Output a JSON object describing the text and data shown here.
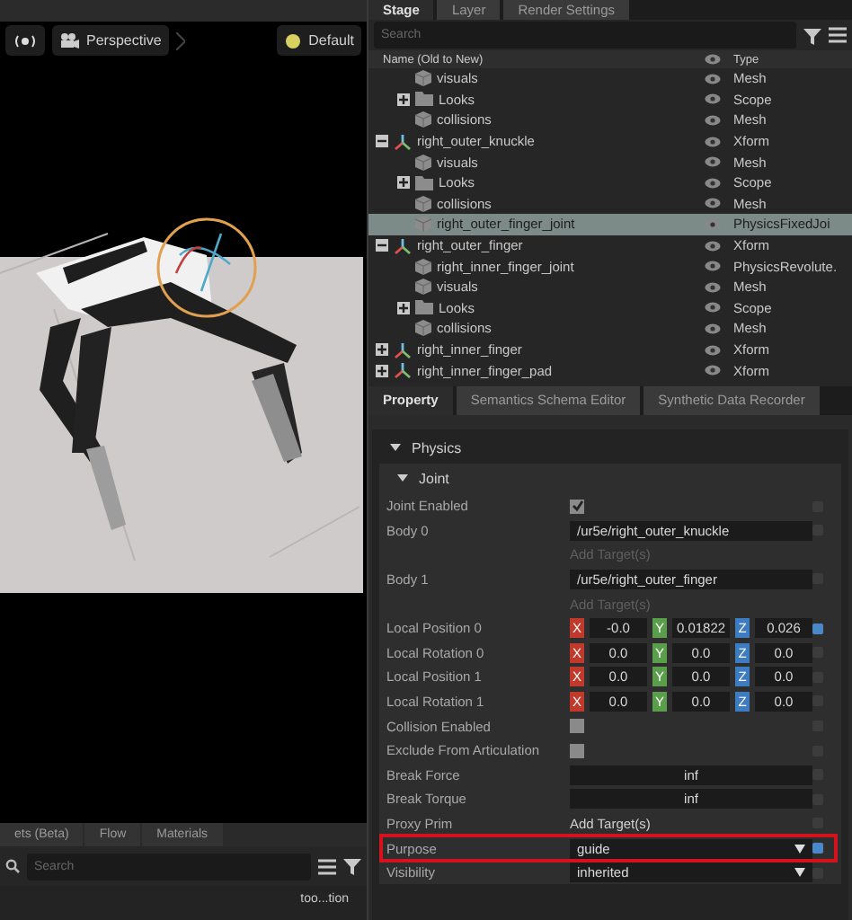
{
  "viewport": {
    "camera": "Perspective",
    "lighting": "Default"
  },
  "bottom_panel": {
    "tabs": [
      {
        "label": "ets (Beta)",
        "selected": false
      },
      {
        "label": "Flow",
        "selected": false
      },
      {
        "label": "Materials",
        "selected": false
      }
    ],
    "search": {
      "placeholder": "Search"
    },
    "tree_item": "too...tion"
  },
  "stage": {
    "tabs": [
      {
        "label": "Stage",
        "selected": true
      },
      {
        "label": "Layer",
        "selected": false
      },
      {
        "label": "Render Settings",
        "selected": false
      }
    ],
    "search": {
      "placeholder": "Search"
    },
    "columns": [
      "Name (Old to New)",
      "Type"
    ],
    "continued_children": [
      {
        "name": "visuals",
        "type": "Mesh",
        "kind": "mesh",
        "selected": false
      },
      {
        "name": "Looks",
        "type": "Scope",
        "kind": "folder",
        "expanded": false,
        "selected": false
      },
      {
        "name": "collisions",
        "type": "Mesh",
        "kind": "mesh",
        "selected": false
      }
    ],
    "nodes": [
      {
        "name": "right_outer_knuckle",
        "type": "Xform",
        "kind": "xform",
        "expanded": true,
        "selected": false,
        "children": [
          {
            "name": "visuals",
            "type": "Mesh",
            "kind": "mesh",
            "selected": false
          },
          {
            "name": "Looks",
            "type": "Scope",
            "kind": "folder",
            "expanded": false,
            "selected": false
          },
          {
            "name": "collisions",
            "type": "Mesh",
            "kind": "mesh",
            "selected": false
          },
          {
            "name": "right_outer_finger_joint",
            "type": "PhysicsFixedJoi",
            "kind": "mesh",
            "selected": true
          }
        ]
      },
      {
        "name": "right_outer_finger",
        "type": "Xform",
        "kind": "xform",
        "expanded": true,
        "selected": false,
        "children": [
          {
            "name": "right_inner_finger_joint",
            "type": "PhysicsRevolute.",
            "kind": "mesh",
            "selected": false
          },
          {
            "name": "visuals",
            "type": "Mesh",
            "kind": "mesh",
            "selected": false
          },
          {
            "name": "Looks",
            "type": "Scope",
            "kind": "folder",
            "expanded": false,
            "selected": false
          },
          {
            "name": "collisions",
            "type": "Mesh",
            "kind": "mesh",
            "selected": false
          }
        ]
      },
      {
        "name": "right_inner_finger",
        "type": "Xform",
        "kind": "xform",
        "expanded": false,
        "selected": false
      },
      {
        "name": "right_inner_finger_pad",
        "type": "Xform",
        "kind": "xform",
        "expanded": false,
        "selected": false
      }
    ]
  },
  "property": {
    "tabs": [
      {
        "label": "Property",
        "selected": true
      },
      {
        "label": "Semantics Schema Editor",
        "selected": false
      },
      {
        "label": "Synthetic Data Recorder",
        "selected": false
      }
    ],
    "section": {
      "title": "Physics",
      "expanded": true
    },
    "group": {
      "title": "Joint",
      "expanded": true
    },
    "fields": [
      {
        "kind": "checkbox",
        "label": "Joint Enabled",
        "checked": true,
        "keyed": false,
        "highlighted": false
      },
      {
        "kind": "target",
        "label": "Body 0",
        "value": "/ur5e/right_outer_knuckle",
        "add_label": "Add Target(s)",
        "keyed": false,
        "highlighted": false
      },
      {
        "kind": "target",
        "label": "Body 1",
        "value": "/ur5e/right_outer_finger",
        "add_label": "Add Target(s)",
        "keyed": false,
        "highlighted": false
      },
      {
        "kind": "vector",
        "label": "Local Position 0",
        "components": [
          {
            "axis": "X",
            "value": "-0.0",
            "color": "#c0392b"
          },
          {
            "axis": "Y",
            "value": "0.01822",
            "color": "#5a9e4b"
          },
          {
            "axis": "Z",
            "value": "0.026",
            "color": "#3d7cc0"
          }
        ],
        "keyed": true,
        "highlighted": false
      },
      {
        "kind": "vector",
        "label": "Local Rotation 0",
        "components": [
          {
            "axis": "X",
            "value": "0.0",
            "color": "#c0392b"
          },
          {
            "axis": "Y",
            "value": "0.0",
            "color": "#5a9e4b"
          },
          {
            "axis": "Z",
            "value": "0.0",
            "color": "#3d7cc0"
          }
        ],
        "keyed": false,
        "highlighted": false
      },
      {
        "kind": "vector",
        "label": "Local Position 1",
        "components": [
          {
            "axis": "X",
            "value": "0.0",
            "color": "#c0392b"
          },
          {
            "axis": "Y",
            "value": "0.0",
            "color": "#5a9e4b"
          },
          {
            "axis": "Z",
            "value": "0.0",
            "color": "#3d7cc0"
          }
        ],
        "keyed": false,
        "highlighted": false
      },
      {
        "kind": "vector",
        "label": "Local Rotation 1",
        "components": [
          {
            "axis": "X",
            "value": "0.0",
            "color": "#c0392b"
          },
          {
            "axis": "Y",
            "value": "0.0",
            "color": "#5a9e4b"
          },
          {
            "axis": "Z",
            "value": "0.0",
            "color": "#3d7cc0"
          }
        ],
        "keyed": false,
        "highlighted": false
      },
      {
        "kind": "checkbox",
        "label": "Collision Enabled",
        "checked": false,
        "keyed": false,
        "highlighted": false
      },
      {
        "kind": "checkbox",
        "label": "Exclude From Articulation",
        "checked": false,
        "keyed": false,
        "highlighted": false
      },
      {
        "kind": "number",
        "label": "Break Force",
        "value": "inf",
        "keyed": false,
        "highlighted": false
      },
      {
        "kind": "number",
        "label": "Break Torque",
        "value": "inf",
        "keyed": false,
        "highlighted": false
      },
      {
        "kind": "target",
        "label": "Proxy Prim",
        "add_label": "Add Target(s)",
        "keyed": false,
        "highlighted": false
      },
      {
        "kind": "dropdown",
        "label": "Purpose",
        "value": "guide",
        "keyed": true,
        "highlighted": true
      },
      {
        "kind": "dropdown",
        "label": "Visibility",
        "value": "inherited",
        "keyed": false,
        "highlighted": false
      }
    ]
  }
}
